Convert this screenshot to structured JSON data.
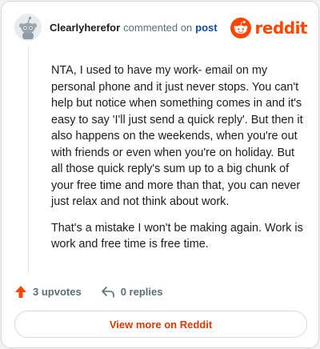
{
  "comment": {
    "username": "Clearlyherefor",
    "action": "commented on",
    "post_link": "post",
    "paragraphs": [
      "NTA, I used to have my work- email on my personal phone and it just never stops. You can't help but notice when something comes in and it's easy to say 'I'll just send a quick reply'. But then it also happens on the weekends, when you're out with friends or even when you're on holiday. But all those quick reply's sum up to a big chunk of your free time and more than that, you can never just relax and not think about work.",
      "That's a mistake I won't be making again. Work is work and free time is free time."
    ]
  },
  "brand": {
    "wordmark": "reddit",
    "accent": "#ff4500"
  },
  "footer": {
    "upvotes": "3 upvotes",
    "replies": "0 replies",
    "upvote_icon": "upvote-arrow-icon",
    "reply_icon": "reply-arrow-icon"
  },
  "view_more": {
    "label": "View more on Reddit",
    "color": "#d93a00"
  }
}
